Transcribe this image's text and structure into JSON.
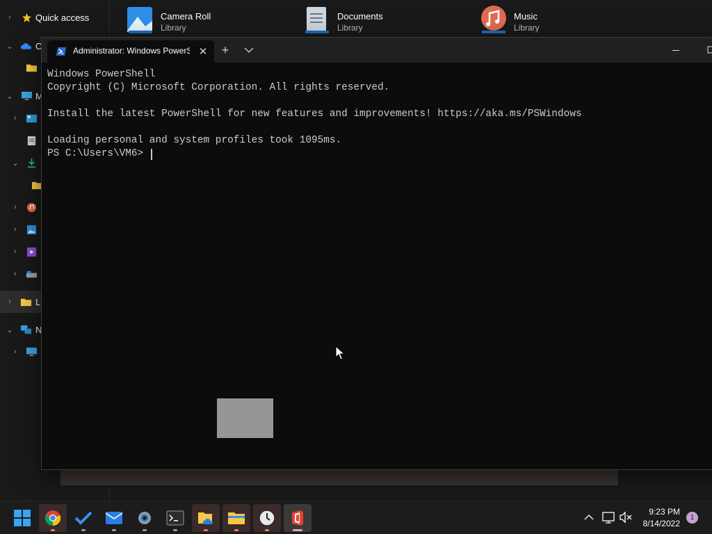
{
  "explorer": {
    "nav": {
      "quick_access_label": "Quick access",
      "onedrive_label": "O",
      "this_pc_label": "M",
      "libraries_label": "Li",
      "network_label": "N"
    },
    "libraries": [
      {
        "name": "Camera Roll",
        "sub": "Library"
      },
      {
        "name": "Documents",
        "sub": "Library"
      },
      {
        "name": "Music",
        "sub": "Library"
      }
    ]
  },
  "terminal": {
    "tab_title": "Administrator: Windows PowerShell",
    "tab_close": "✕",
    "new_tab": "+",
    "lines": [
      "Windows PowerShell",
      "Copyright (C) Microsoft Corporation. All rights reserved.",
      "",
      "Install the latest PowerShell for new features and improvements! https://aka.ms/PSWindows",
      "",
      "Loading personal and system profiles took 1095ms."
    ],
    "prompt": "PS C:\\Users\\VM6> "
  },
  "taskbar": {
    "apps": [
      "start-icon",
      "chrome-icon",
      "todo-icon",
      "mail-icon",
      "settings-icon",
      "terminal-icon",
      "onedrive-explorer-icon",
      "file-explorer-icon",
      "clock-icon",
      "office-icon"
    ],
    "clock_time": "9:23 PM",
    "clock_date": "8/14/2022",
    "notification_count": "1"
  },
  "colors": {
    "terminal_bg": "#0c0c0c",
    "terminal_text": "#cccccc",
    "titlebar": "#202020",
    "taskbar": "#1c1c1c"
  }
}
